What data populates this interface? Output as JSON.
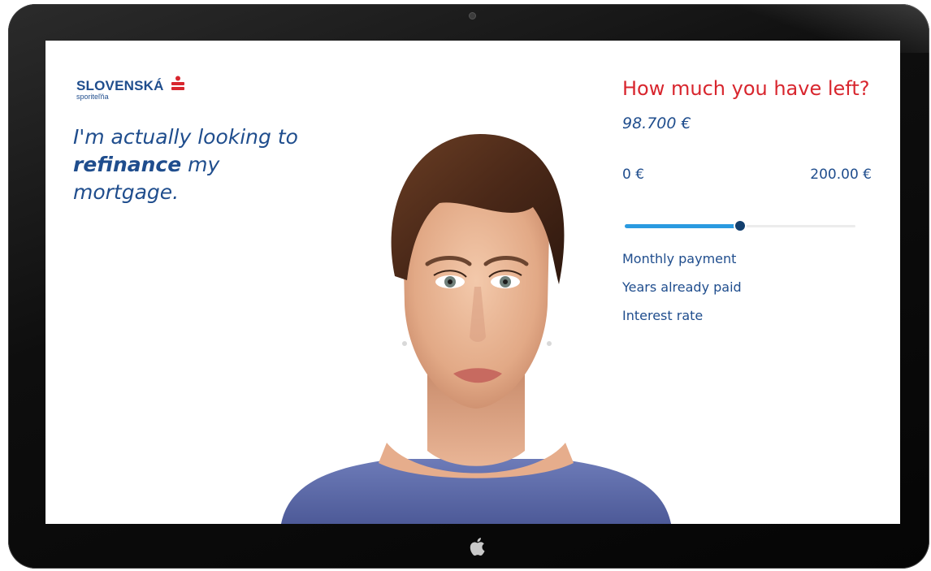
{
  "brand": {
    "name": "SLOVENSKÁ",
    "subtitle": "sporiteľňa",
    "accent_color": "#d8262e",
    "text_color": "#1f4d8d"
  },
  "speech": {
    "line_prefix": "I'm actually looking to ",
    "emphasis": "refinance",
    "line_suffix": " my mortgage."
  },
  "panel": {
    "question": "How much you have left?",
    "amount": "98.700 €",
    "range_min_label": "0 €",
    "range_max_label": "200.00 €",
    "slider_fraction": 0.5,
    "slider_fill_color": "#2a9ae0",
    "options": [
      "Monthly payment",
      "Years already paid",
      "Interest rate"
    ]
  },
  "icons": {
    "device_logo": "apple-logo-icon",
    "brand_mark": "sporitelna-logo-icon"
  }
}
